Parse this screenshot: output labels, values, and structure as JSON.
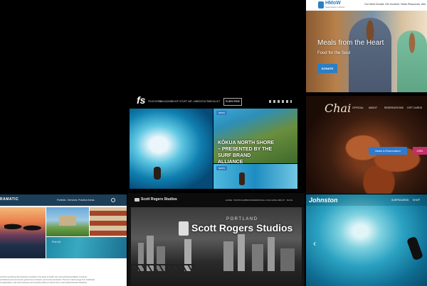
{
  "hmow": {
    "logo": "HMoW",
    "logo_sub": "Hawaii Meals on Wheels",
    "nav": [
      "Our Work",
      "Donate",
      "Get Involved",
      "News",
      "Resources",
      "Abo"
    ],
    "headline": "Meals from the Heart",
    "subhead": "Food for the Soul",
    "cta": "DONATE"
  },
  "fs": {
    "logo": "fs",
    "nav": [
      "FEATURES",
      "MAGAZINE",
      "SHOP",
      "STUFF WE LIKE",
      "CONTACT",
      "MEDIA KIT"
    ],
    "subscribe": "SUBSCRIBE",
    "badge1": "NEWS",
    "headline": "KŌKUA NORTH SHORE – PRESENTED BY THE SURF BRAND ALLIANCE",
    "badge2": "NEWS"
  },
  "chai": {
    "logo": "Chai",
    "nav": [
      "OFFICIAL",
      "ABOUT",
      "RESERVATIONS",
      "GIFT CARDS"
    ],
    "cta1": "Make A Reservation",
    "cta2": "ORD"
  },
  "ramatic": {
    "logo": "RAMATIC",
    "nav": [
      "Portfolio",
      "Services",
      "Practice Areas"
    ],
    "caption": "Fine Art",
    "body_line1": "ional firm practicing with particular emphasis in the areas of health care and professional liability, insurance",
    "body_line2": "nal defense and commercial, government contracts, and environmental law. The firm's clients range from individuals",
    "body_line3": "ll organizations, and other business and nonprofit entities of various sizes, and include financial institutions"
  },
  "scott": {
    "logo": "Scott Rogers Studios",
    "nav": [
      "HOME",
      "PORTFOLIO",
      "PRICING",
      "PERSONAL COACHING",
      "ABOUT",
      "BLOG"
    ],
    "city": "PORTLAND",
    "title": "Scott Rogers Studios"
  },
  "johnston": {
    "logo": "Johnston",
    "nav": [
      "SURFBOARDS",
      "SHOP"
    ],
    "arrow": "‹"
  }
}
